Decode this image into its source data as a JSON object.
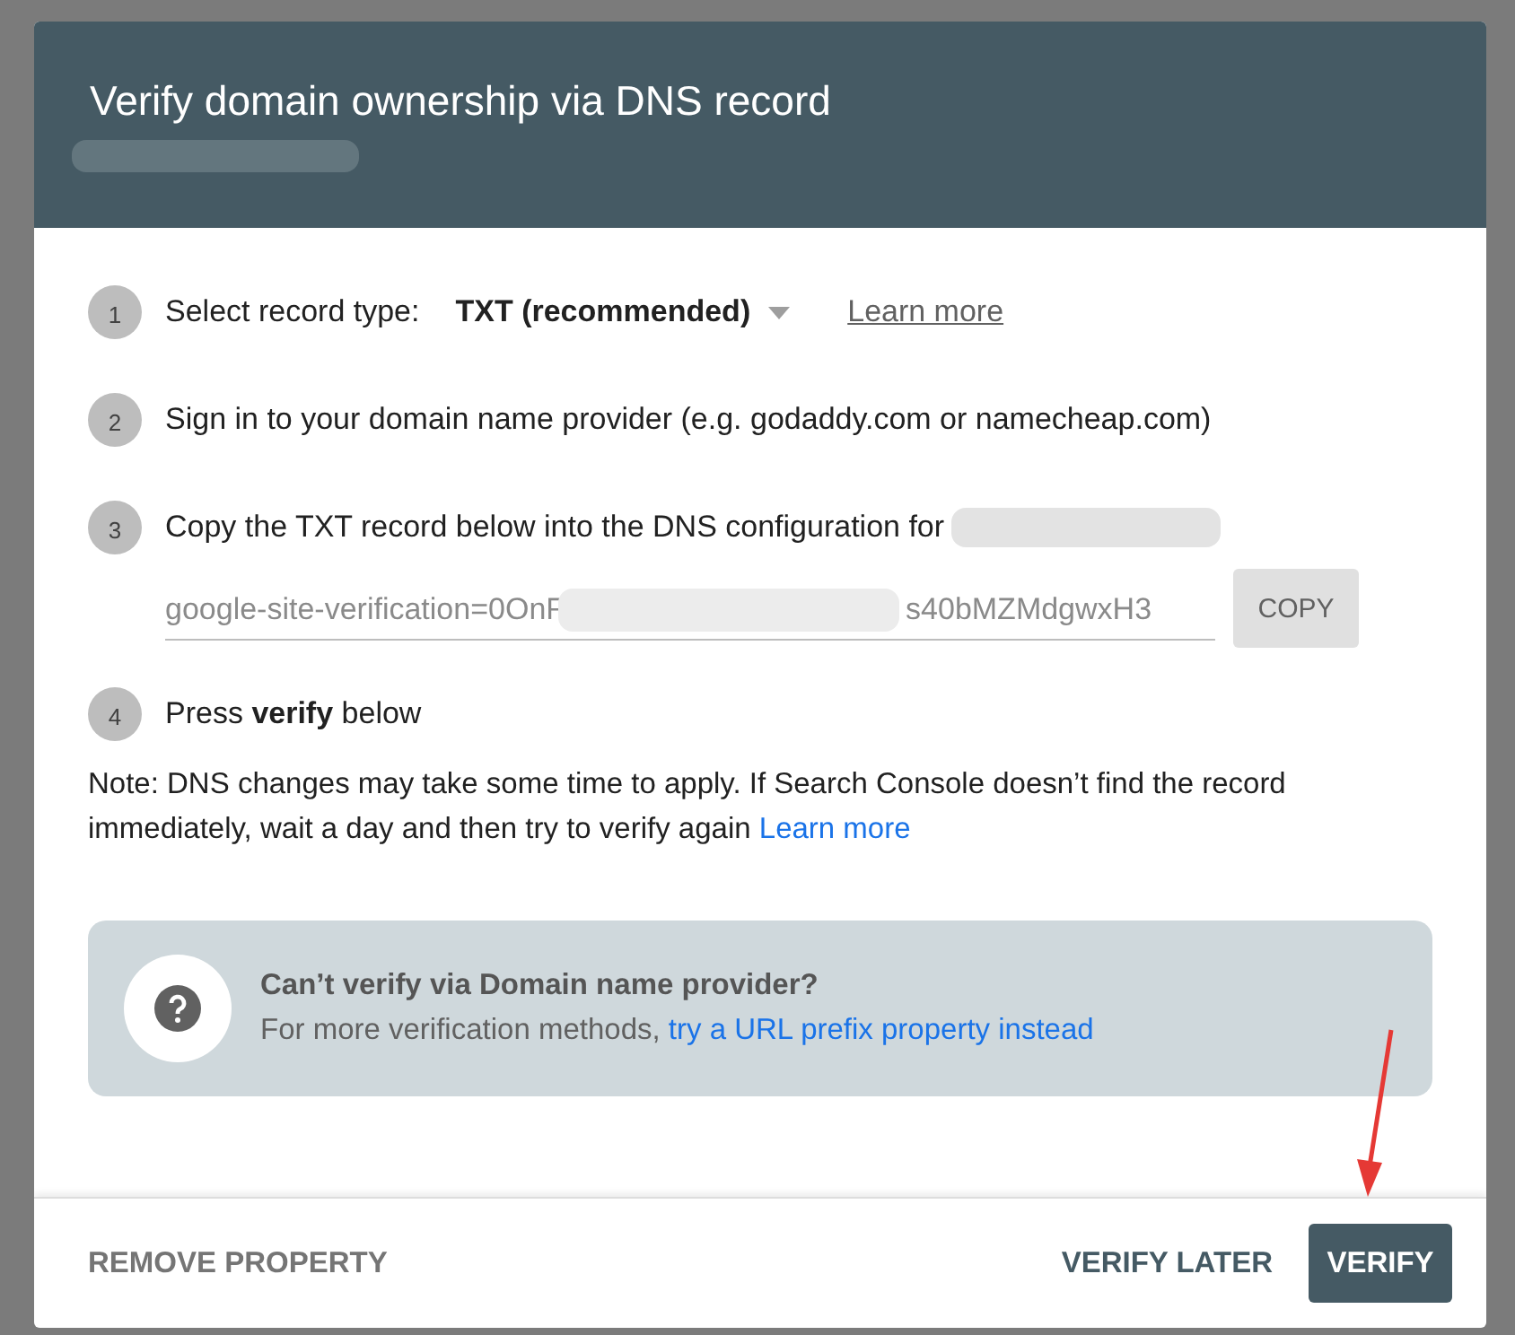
{
  "dialog": {
    "title": "Verify domain ownership via DNS record",
    "steps": [
      {
        "number": "1",
        "kind": "select",
        "label": "Select record type:",
        "value": "TXT (recommended)",
        "link": "Learn more"
      },
      {
        "number": "2",
        "kind": "text",
        "label": "Sign in to your domain name provider (e.g. godaddy.com or namecheap.com)"
      },
      {
        "number": "3",
        "kind": "record",
        "label": "Copy the TXT record below into the DNS configuration for",
        "record_start": "google-site-verification=0OnF",
        "record_end": "s40bMZMdgwxH3",
        "button": "COPY"
      },
      {
        "number": "4",
        "kind": "text",
        "label": "Press **verify** below"
      }
    ],
    "note": "Note: DNS changes may take some time to apply. If Search Console doesn’t find the record immediately, wait a day and then try to verify again",
    "note_link": "Learn more",
    "help": {
      "title": "Can’t verify via Domain name provider?",
      "text": "For more verification methods,",
      "link": "try a URL prefix property instead"
    },
    "buttons": [
      {
        "label": "REMOVE PROPERTY",
        "kind": "flat"
      },
      {
        "label": "VERIFY LATER",
        "kind": "flat"
      },
      {
        "label": "VERIFY",
        "kind": "primary"
      }
    ]
  }
}
